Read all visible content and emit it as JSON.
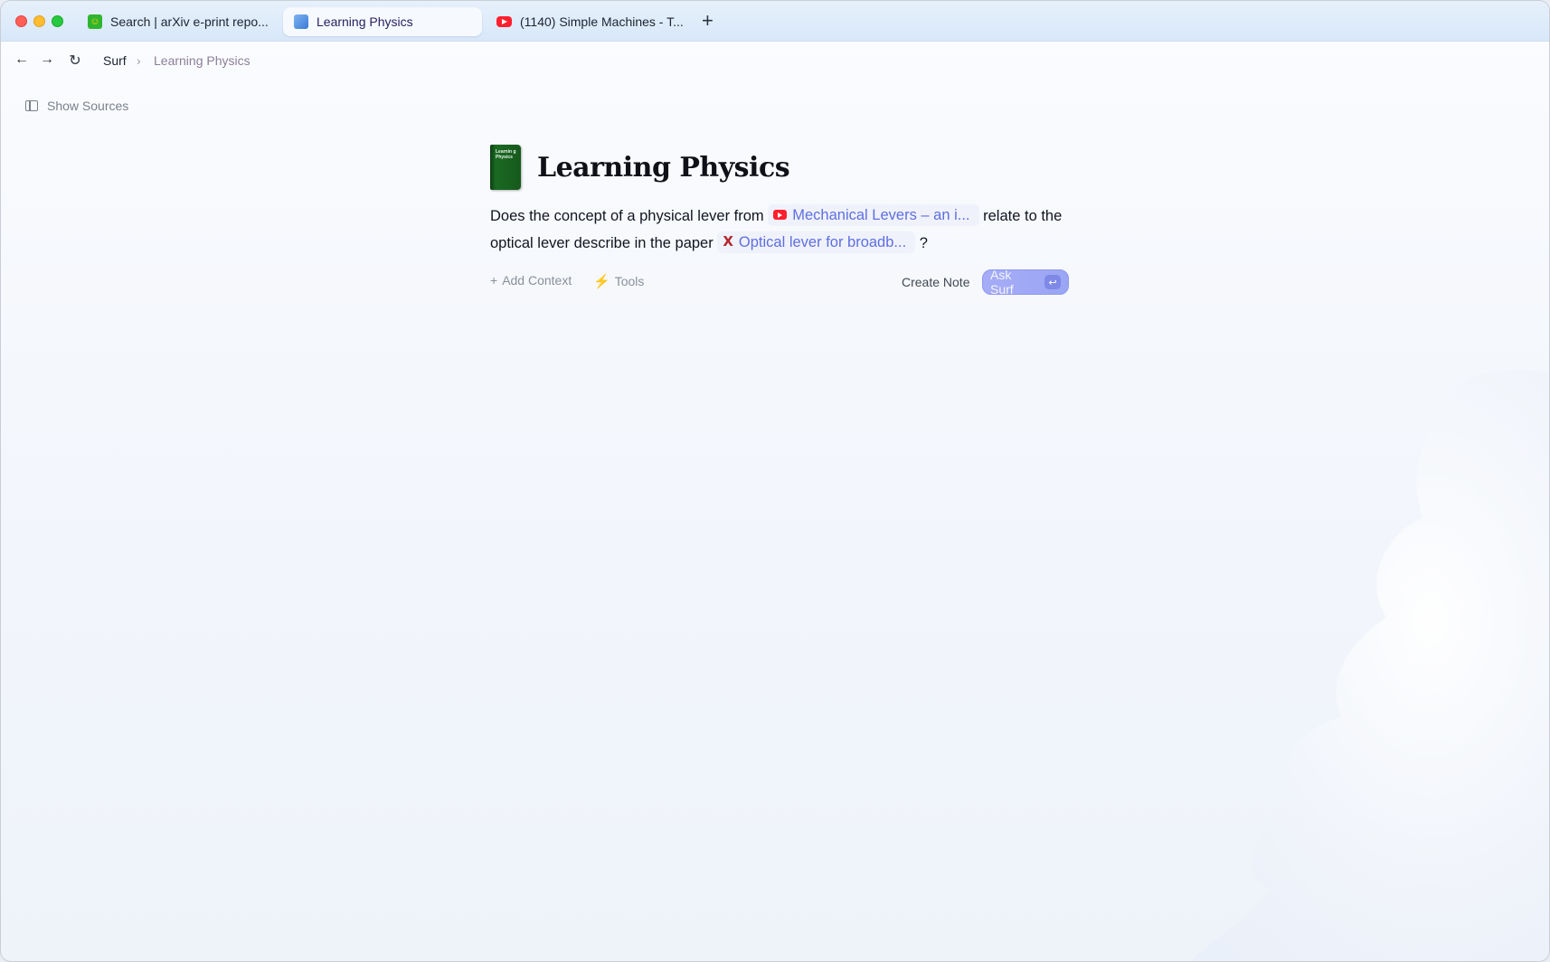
{
  "tabs": [
    {
      "label": "Search | arXiv e-print repo...",
      "icon": "arxiv-icon",
      "active": false
    },
    {
      "label": "Learning Physics",
      "icon": "surf-icon",
      "active": true
    },
    {
      "label": "(1140) Simple Machines - T...",
      "icon": "youtube-icon",
      "active": false
    }
  ],
  "new_tab_label": "+",
  "nav": {
    "back": "←",
    "forward": "→",
    "reload": "↻",
    "breadcrumb_root": "Surf",
    "breadcrumb_sep": "›",
    "breadcrumb_current": "Learning Physics"
  },
  "sidebar": {
    "show_sources_label": "Show Sources"
  },
  "page": {
    "cover_text": "Learnin g Physics",
    "title": "Learning Physics"
  },
  "prompt": {
    "part1": "Does the concept of a physical lever from",
    "chip1": "Mechanical Levers – an i...",
    "part2": "relate to the optical lever describe in the paper",
    "chip2": "Optical lever for broadb...",
    "part3": "?"
  },
  "actions": {
    "add_context": "Add Context",
    "tools": "Tools",
    "create_note": "Create Note",
    "ask_surf": "Ask Surf",
    "enter_symbol": "↩"
  },
  "colors": {
    "accent": "#5e6fe0",
    "ask_button": "#a6acf6",
    "youtube": "#ff1f2e"
  }
}
